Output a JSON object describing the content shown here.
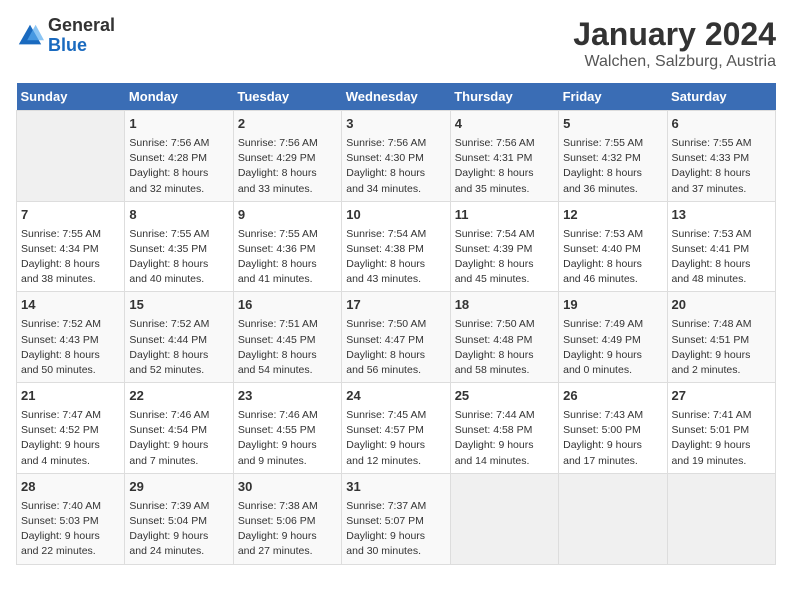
{
  "logo": {
    "general": "General",
    "blue": "Blue"
  },
  "title": "January 2024",
  "subtitle": "Walchen, Salzburg, Austria",
  "days_header": [
    "Sunday",
    "Monday",
    "Tuesday",
    "Wednesday",
    "Thursday",
    "Friday",
    "Saturday"
  ],
  "weeks": [
    [
      {
        "day": "",
        "info": ""
      },
      {
        "day": "1",
        "info": "Sunrise: 7:56 AM\nSunset: 4:28 PM\nDaylight: 8 hours\nand 32 minutes."
      },
      {
        "day": "2",
        "info": "Sunrise: 7:56 AM\nSunset: 4:29 PM\nDaylight: 8 hours\nand 33 minutes."
      },
      {
        "day": "3",
        "info": "Sunrise: 7:56 AM\nSunset: 4:30 PM\nDaylight: 8 hours\nand 34 minutes."
      },
      {
        "day": "4",
        "info": "Sunrise: 7:56 AM\nSunset: 4:31 PM\nDaylight: 8 hours\nand 35 minutes."
      },
      {
        "day": "5",
        "info": "Sunrise: 7:55 AM\nSunset: 4:32 PM\nDaylight: 8 hours\nand 36 minutes."
      },
      {
        "day": "6",
        "info": "Sunrise: 7:55 AM\nSunset: 4:33 PM\nDaylight: 8 hours\nand 37 minutes."
      }
    ],
    [
      {
        "day": "7",
        "info": "Sunrise: 7:55 AM\nSunset: 4:34 PM\nDaylight: 8 hours\nand 38 minutes."
      },
      {
        "day": "8",
        "info": "Sunrise: 7:55 AM\nSunset: 4:35 PM\nDaylight: 8 hours\nand 40 minutes."
      },
      {
        "day": "9",
        "info": "Sunrise: 7:55 AM\nSunset: 4:36 PM\nDaylight: 8 hours\nand 41 minutes."
      },
      {
        "day": "10",
        "info": "Sunrise: 7:54 AM\nSunset: 4:38 PM\nDaylight: 8 hours\nand 43 minutes."
      },
      {
        "day": "11",
        "info": "Sunrise: 7:54 AM\nSunset: 4:39 PM\nDaylight: 8 hours\nand 45 minutes."
      },
      {
        "day": "12",
        "info": "Sunrise: 7:53 AM\nSunset: 4:40 PM\nDaylight: 8 hours\nand 46 minutes."
      },
      {
        "day": "13",
        "info": "Sunrise: 7:53 AM\nSunset: 4:41 PM\nDaylight: 8 hours\nand 48 minutes."
      }
    ],
    [
      {
        "day": "14",
        "info": "Sunrise: 7:52 AM\nSunset: 4:43 PM\nDaylight: 8 hours\nand 50 minutes."
      },
      {
        "day": "15",
        "info": "Sunrise: 7:52 AM\nSunset: 4:44 PM\nDaylight: 8 hours\nand 52 minutes."
      },
      {
        "day": "16",
        "info": "Sunrise: 7:51 AM\nSunset: 4:45 PM\nDaylight: 8 hours\nand 54 minutes."
      },
      {
        "day": "17",
        "info": "Sunrise: 7:50 AM\nSunset: 4:47 PM\nDaylight: 8 hours\nand 56 minutes."
      },
      {
        "day": "18",
        "info": "Sunrise: 7:50 AM\nSunset: 4:48 PM\nDaylight: 8 hours\nand 58 minutes."
      },
      {
        "day": "19",
        "info": "Sunrise: 7:49 AM\nSunset: 4:49 PM\nDaylight: 9 hours\nand 0 minutes."
      },
      {
        "day": "20",
        "info": "Sunrise: 7:48 AM\nSunset: 4:51 PM\nDaylight: 9 hours\nand 2 minutes."
      }
    ],
    [
      {
        "day": "21",
        "info": "Sunrise: 7:47 AM\nSunset: 4:52 PM\nDaylight: 9 hours\nand 4 minutes."
      },
      {
        "day": "22",
        "info": "Sunrise: 7:46 AM\nSunset: 4:54 PM\nDaylight: 9 hours\nand 7 minutes."
      },
      {
        "day": "23",
        "info": "Sunrise: 7:46 AM\nSunset: 4:55 PM\nDaylight: 9 hours\nand 9 minutes."
      },
      {
        "day": "24",
        "info": "Sunrise: 7:45 AM\nSunset: 4:57 PM\nDaylight: 9 hours\nand 12 minutes."
      },
      {
        "day": "25",
        "info": "Sunrise: 7:44 AM\nSunset: 4:58 PM\nDaylight: 9 hours\nand 14 minutes."
      },
      {
        "day": "26",
        "info": "Sunrise: 7:43 AM\nSunset: 5:00 PM\nDaylight: 9 hours\nand 17 minutes."
      },
      {
        "day": "27",
        "info": "Sunrise: 7:41 AM\nSunset: 5:01 PM\nDaylight: 9 hours\nand 19 minutes."
      }
    ],
    [
      {
        "day": "28",
        "info": "Sunrise: 7:40 AM\nSunset: 5:03 PM\nDaylight: 9 hours\nand 22 minutes."
      },
      {
        "day": "29",
        "info": "Sunrise: 7:39 AM\nSunset: 5:04 PM\nDaylight: 9 hours\nand 24 minutes."
      },
      {
        "day": "30",
        "info": "Sunrise: 7:38 AM\nSunset: 5:06 PM\nDaylight: 9 hours\nand 27 minutes."
      },
      {
        "day": "31",
        "info": "Sunrise: 7:37 AM\nSunset: 5:07 PM\nDaylight: 9 hours\nand 30 minutes."
      },
      {
        "day": "",
        "info": ""
      },
      {
        "day": "",
        "info": ""
      },
      {
        "day": "",
        "info": ""
      }
    ]
  ]
}
